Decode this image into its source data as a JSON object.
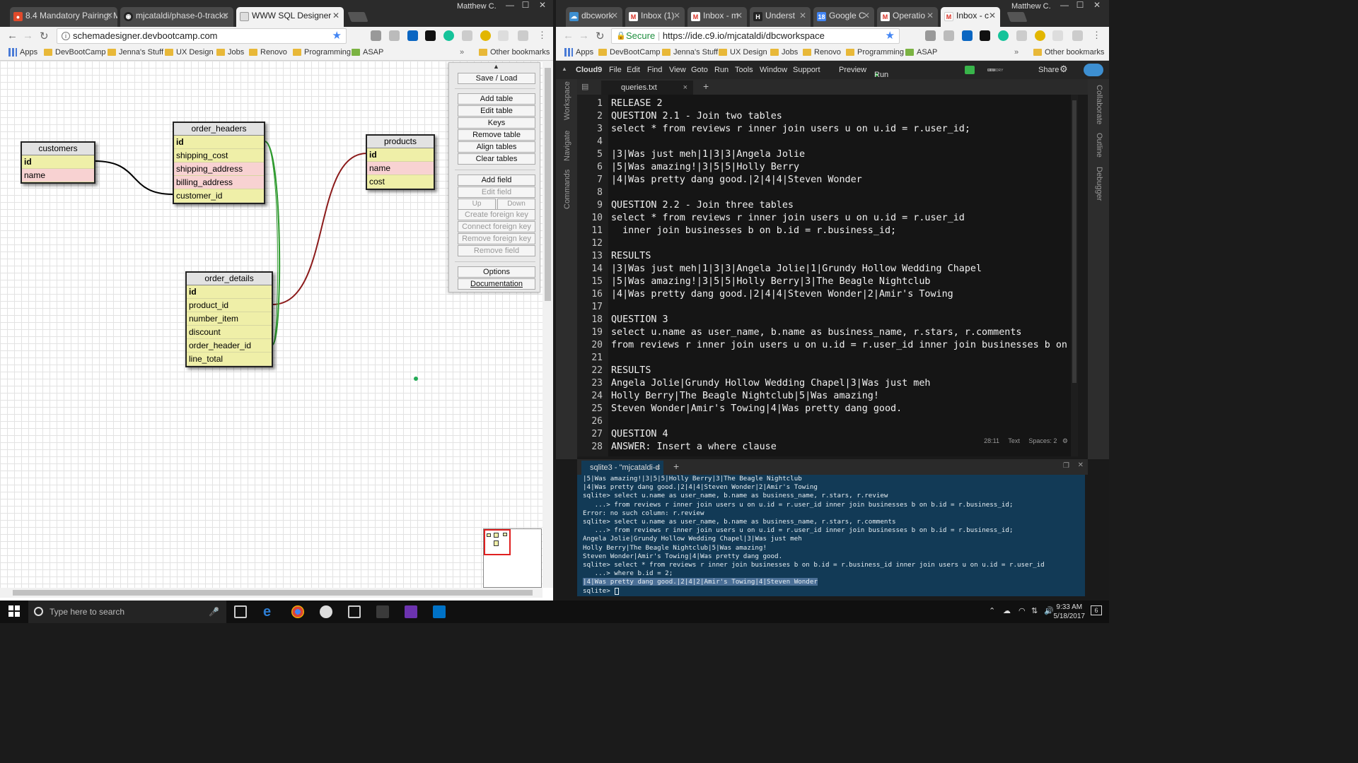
{
  "left_window": {
    "user": "Matthew C.",
    "tabs": [
      {
        "label": "8.4 Mandatory Pairing: M",
        "icon": "devbootcamp-icon"
      },
      {
        "label": "mjcataldi/phase-0-tracks",
        "icon": "github-icon"
      },
      {
        "label": "WWW SQL Designer",
        "icon": "page-icon",
        "active": true
      }
    ],
    "url": "schemadesigner.devbootcamp.com",
    "bookmarks": [
      "Apps",
      "DevBootCamp",
      "Jenna's Stuff",
      "UX Design",
      "Jobs",
      "Renovo",
      "Programming",
      "ASAP"
    ],
    "other_bookmarks": "Other bookmarks"
  },
  "schema": {
    "tables": [
      {
        "name": "customers",
        "fields": [
          {
            "name": "id",
            "kind": "pk"
          },
          {
            "name": "name",
            "kind": "fk"
          }
        ]
      },
      {
        "name": "order_headers",
        "fields": [
          {
            "name": "id",
            "kind": "pk"
          },
          {
            "name": "shipping_cost",
            "kind": "plain"
          },
          {
            "name": "shipping_address",
            "kind": "fk"
          },
          {
            "name": "billing_address",
            "kind": "fk"
          },
          {
            "name": "customer_id",
            "kind": "plain"
          }
        ]
      },
      {
        "name": "products",
        "fields": [
          {
            "name": "id",
            "kind": "pk"
          },
          {
            "name": "name",
            "kind": "fk"
          },
          {
            "name": "cost",
            "kind": "plain"
          }
        ]
      },
      {
        "name": "order_details",
        "fields": [
          {
            "name": "id",
            "kind": "pk"
          },
          {
            "name": "product_id",
            "kind": "plain"
          },
          {
            "name": "number_item",
            "kind": "plain"
          },
          {
            "name": "discount",
            "kind": "plain"
          },
          {
            "name": "order_header_id",
            "kind": "plain"
          },
          {
            "name": "line_total",
            "kind": "plain"
          }
        ]
      }
    ],
    "relation_colors": {
      "customer": "#000000",
      "product": "#8b1a1a",
      "order_header": "#2e9a2e"
    }
  },
  "panel": {
    "save_load": "Save / Load",
    "table_buttons": [
      "Add table",
      "Edit table",
      "Keys",
      "Remove table",
      "Align tables",
      "Clear tables"
    ],
    "field_buttons": [
      "Add field",
      "Edit field"
    ],
    "up": "Up",
    "down": "Down",
    "key_buttons": [
      "Create foreign key",
      "Connect foreign key",
      "Remove foreign key",
      "Remove field"
    ],
    "options": "Options",
    "documentation": "Documentation"
  },
  "right_window": {
    "user": "Matthew C.",
    "tabs": [
      {
        "label": "dbcwork",
        "icon": "cloud9-icon"
      },
      {
        "label": "Inbox (1)",
        "icon": "gmail-icon"
      },
      {
        "label": "Inbox - m",
        "icon": "gmail-icon"
      },
      {
        "label": "Underst",
        "icon": "hackerrank-icon"
      },
      {
        "label": "Google C",
        "icon": "calendar-icon"
      },
      {
        "label": "Operatio",
        "icon": "gmail-icon"
      },
      {
        "label": "Inbox - c",
        "icon": "gmail-icon",
        "active": true
      }
    ],
    "secure_label": "Secure",
    "url": "https://ide.c9.io/mjcataldi/dbcworkspace",
    "bookmarks": [
      "Apps",
      "DevBootCamp",
      "Jenna's Stuff",
      "UX Design",
      "Jobs",
      "Renovo",
      "Programming",
      "ASAP"
    ],
    "other_bookmarks": "Other bookmarks"
  },
  "c9": {
    "menu": [
      "Cloud9",
      "File",
      "Edit",
      "Find",
      "View",
      "Goto",
      "Run",
      "Tools",
      "Window",
      "Support"
    ],
    "preview": "Preview",
    "run": "Run",
    "share": "Share",
    "monitor_labels": [
      "MEMORY",
      "CPU",
      "DISK"
    ],
    "left_sidebar": [
      "Workspace",
      "Navigate",
      "Commands"
    ],
    "right_sidebar": [
      "Collaborate",
      "Outline",
      "Debugger"
    ],
    "file_tab": "queries.txt",
    "lines": [
      "RELEASE 2",
      "QUESTION 2.1 - Join two tables",
      "select * from reviews r inner join users u on u.id = r.user_id;",
      "",
      "|3|Was just meh|1|3|3|Angela Jolie",
      "|5|Was amazing!|3|5|5|Holly Berry",
      "|4|Was pretty dang good.|2|4|4|Steven Wonder",
      "",
      "QUESTION 2.2 - Join three tables",
      "select * from reviews r inner join users u on u.id = r.user_id",
      "  inner join businesses b on b.id = r.business_id;",
      "",
      "RESULTS",
      "|3|Was just meh|1|3|3|Angela Jolie|1|Grundy Hollow Wedding Chapel",
      "|5|Was amazing!|3|5|5|Holly Berry|3|The Beagle Nightclub",
      "|4|Was pretty dang good.|2|4|4|Steven Wonder|2|Amir's Towing",
      "",
      "QUESTION 3",
      "select u.name as user_name, b.name as business_name, r.stars, r.comments",
      "from reviews r inner join users u on u.id = r.user_id inner join businesses b on b",
      "",
      "RESULTS",
      "Angela Jolie|Grundy Hollow Wedding Chapel|3|Was just meh",
      "Holly Berry|The Beagle Nightclub|5|Was amazing!",
      "Steven Wonder|Amir's Towing|4|Was pretty dang good.",
      "",
      "QUESTION 4",
      "ANSWER: Insert a where clause"
    ],
    "status": {
      "position": "28:11",
      "mode": "Text",
      "spaces": "Spaces: 2"
    },
    "terminal_tab": "sqlite3 - \"mjcataldi-d",
    "terminal": [
      "|5|Was amazing!|3|5|5|Holly Berry|3|The Beagle Nightclub",
      "|4|Was pretty dang good.|2|4|4|Steven Wonder|2|Amir's Towing",
      "sqlite> select u.name as user_name, b.name as business_name, r.stars, r.review",
      "   ...> from reviews r inner join users u on u.id = r.user_id inner join businesses b on b.id = r.business_id;",
      "Error: no such column: r.review",
      "sqlite> select u.name as user_name, b.name as business_name, r.stars, r.comments",
      "   ...> from reviews r inner join users u on u.id = r.user_id inner join businesses b on b.id = r.business_id;",
      "Angela Jolie|Grundy Hollow Wedding Chapel|3|Was just meh",
      "Holly Berry|The Beagle Nightclub|5|Was amazing!",
      "Steven Wonder|Amir's Towing|4|Was pretty dang good.",
      "sqlite> select * from reviews r inner join businesses b on b.id = r.business_id inner join users u on u.id = r.user_id",
      "   ...> where b.id = 2;",
      "|4|Was pretty dang good.|2|4|2|Amir's Towing|4|Steven Wonder",
      "sqlite> "
    ],
    "terminal_selected_line": 12
  },
  "taskbar": {
    "search_placeholder": "Type here to search",
    "time": "9:33 AM",
    "date": "5/18/2017",
    "notification_count": "6"
  }
}
